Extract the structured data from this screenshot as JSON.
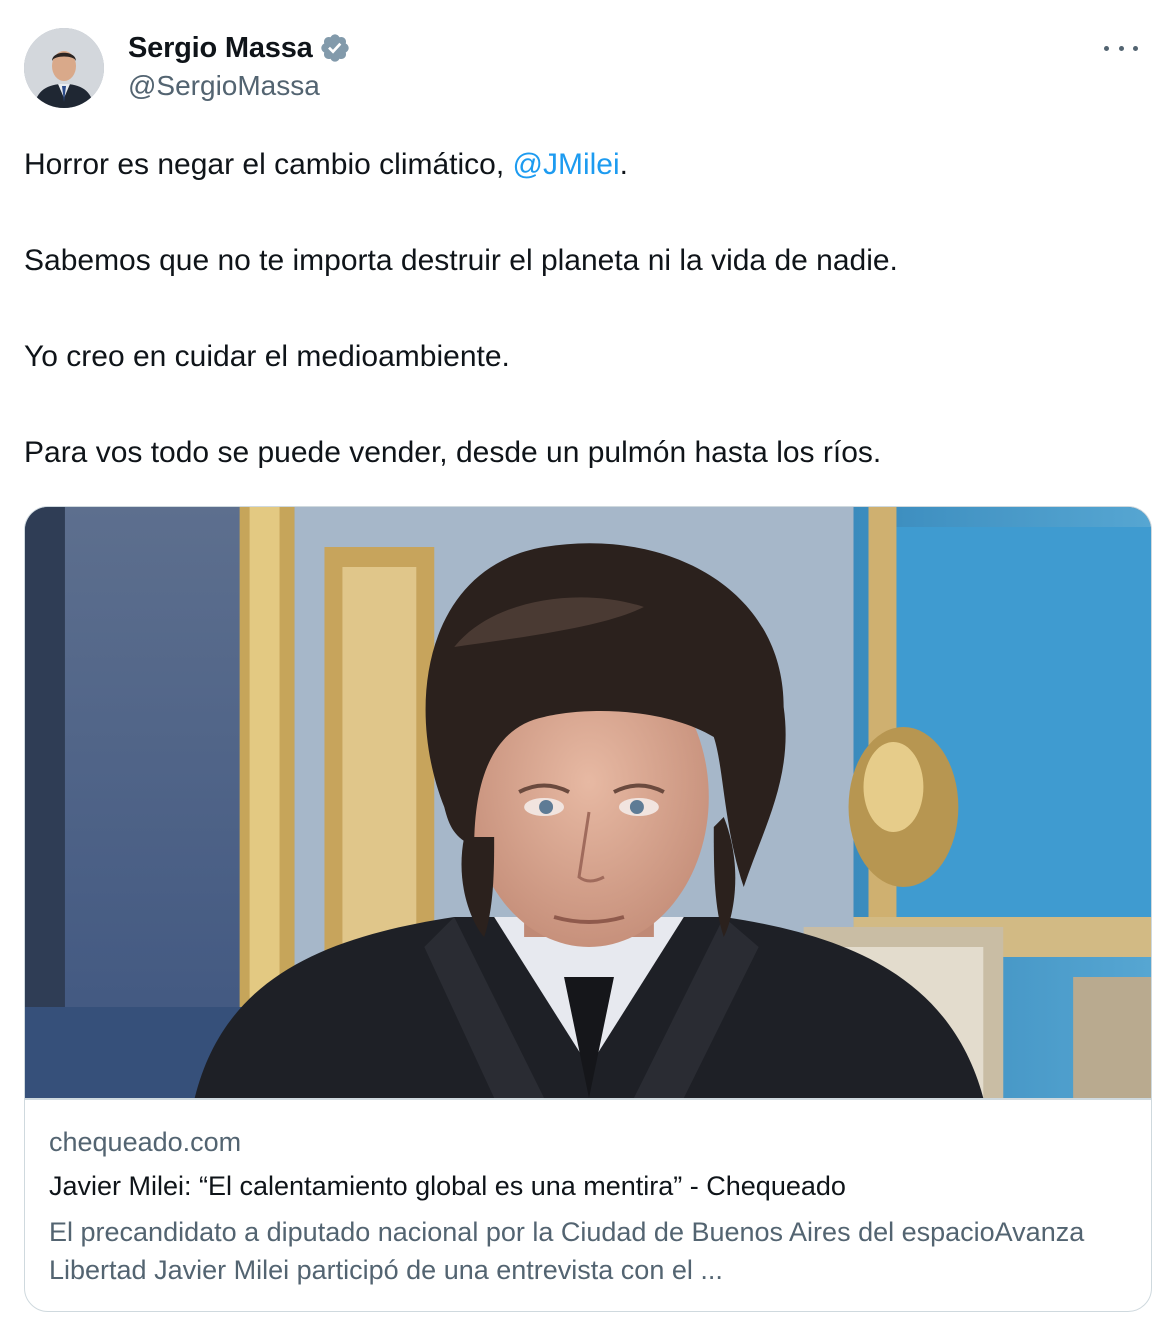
{
  "author": {
    "display_name": "Sergio Massa",
    "handle": "@SergioMassa",
    "verified_icon": "verified-badge-icon",
    "avatar_icon": "profile-photo"
  },
  "menu": {
    "more_icon": "more-options-icon"
  },
  "tweet": {
    "line1_text": "Horror es negar el cambio climático, ",
    "line1_mention": "@JMilei",
    "line1_end": ".",
    "line2": "Sabemos que no te importa destruir el planeta ni la vida de nadie.",
    "line3": "Yo creo en cuidar el medioambiente.",
    "line4": "Para vos todo se puede vender, desde un pulmón hasta los ríos."
  },
  "link_card": {
    "domain": "chequeado.com",
    "title": "Javier Milei: “El calentamiento global es una mentira” - Chequeado",
    "description": "El precandidato a diputado nacional por la Ciudad de Buenos Aires del espacioAvanza Libertad Javier Milei participó de una entrevista con el ...",
    "image_icon": "article-thumbnail-photo"
  },
  "colors": {
    "link_blue": "#1d9bf0",
    "text_primary": "#0f1419",
    "text_secondary": "#536471",
    "border": "#cfd9de"
  }
}
